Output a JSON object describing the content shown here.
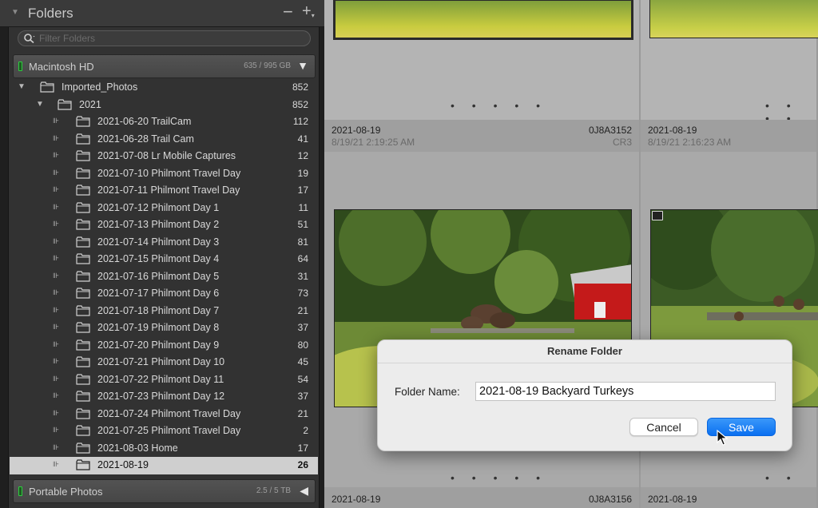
{
  "panel": {
    "title": "Folders",
    "minus": "−",
    "plus": "+",
    "search_placeholder": "Filter Folders"
  },
  "volumes": [
    {
      "name": "Macintosh HD",
      "capacity": "635 / 995 GB"
    },
    {
      "name": "Portable Photos",
      "capacity": "2.5 / 5 TB"
    }
  ],
  "tree": [
    {
      "name": "Imported_Photos",
      "count": "852"
    },
    {
      "name": "2021",
      "count": "852"
    },
    {
      "name": "2021-06-20 TrailCam",
      "count": "112"
    },
    {
      "name": "2021-06-28 Trail Cam",
      "count": "41"
    },
    {
      "name": "2021-07-08 Lr Mobile Captures",
      "count": "12"
    },
    {
      "name": "2021-07-10 Philmont Travel Day",
      "count": "19"
    },
    {
      "name": "2021-07-11 Philmont Travel Day",
      "count": "17"
    },
    {
      "name": "2021-07-12 Philmont Day 1",
      "count": "11"
    },
    {
      "name": "2021-07-13 Philmont Day 2",
      "count": "51"
    },
    {
      "name": "2021-07-14 Philmont Day 3",
      "count": "81"
    },
    {
      "name": "2021-07-15 Philmont Day 4",
      "count": "64"
    },
    {
      "name": "2021-07-16 Philmont Day 5",
      "count": "31"
    },
    {
      "name": "2021-07-17 Philmont Day 6",
      "count": "73"
    },
    {
      "name": "2021-07-18 Philmont Day 7",
      "count": "21"
    },
    {
      "name": "2021-07-19 Philmont Day 8",
      "count": "37"
    },
    {
      "name": "2021-07-20 Philmont Day 9",
      "count": "80"
    },
    {
      "name": "2021-07-21 Philmont Day 10",
      "count": "45"
    },
    {
      "name": "2021-07-22 Philmont Day 11",
      "count": "54"
    },
    {
      "name": "2021-07-23 Philmont Day 12",
      "count": "37"
    },
    {
      "name": "2021-07-24 Philmont Travel Day",
      "count": "21"
    },
    {
      "name": "2021-07-25 Philmont Travel Day",
      "count": "2"
    },
    {
      "name": "2021-08-03 Home",
      "count": "17"
    },
    {
      "name": "2021-08-19",
      "count": "26"
    }
  ],
  "grid": {
    "cells": [
      {
        "date": "2021-08-19",
        "time": "8/19/21 2:19:25 AM",
        "file_id": "0J8A3152",
        "ext": "CR3"
      },
      {
        "date": "2021-08-19",
        "time": "8/19/21 2:16:23 AM"
      },
      {
        "date": "2021-08-19",
        "file_id": "0J8A3156"
      },
      {
        "date": "2021-08-19"
      }
    ],
    "dots": "• • • • •"
  },
  "dialog": {
    "title": "Rename Folder",
    "label": "Folder Name:",
    "value": "2021-08-19 Backyard Turkeys",
    "cancel": "Cancel",
    "save": "Save"
  },
  "colors": {
    "accent": "#0a6ff0",
    "selected_row": "#cfcfcf",
    "led": "#2ecc40"
  }
}
